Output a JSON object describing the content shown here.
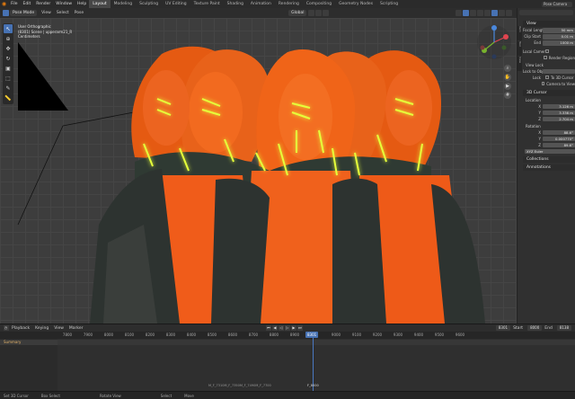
{
  "menu": {
    "items": [
      "File",
      "Edit",
      "Render",
      "Window",
      "Help"
    ],
    "workspaces": [
      "Layout",
      "Modeling",
      "Sculpting",
      "UV Editing",
      "Texture Paint",
      "Shading",
      "Animation",
      "Rendering",
      "Compositing",
      "Geometry Nodes",
      "Scripting"
    ],
    "active_workspace": "Layout",
    "scene": "Pose Camera"
  },
  "viewport_header": {
    "mode": "Pose Mode",
    "menus": [
      "View",
      "Select",
      "Pose"
    ],
    "transform": "Global"
  },
  "viewport": {
    "info_line1": "User Orthographic",
    "info_line2": "(8301) Scene | upperarm21_R",
    "info_line3": "Centimeters",
    "accent": "#4772b3"
  },
  "npanel": {
    "search_placeholder": "",
    "tabs": [
      "Item",
      "Tool",
      "View"
    ],
    "view": {
      "title": "View",
      "focal_length_label": "Focal Length",
      "focal_length": "50 mm",
      "clip_start_label": "Clip Start",
      "clip_start": "0.01 m",
      "clip_end_label": "End",
      "clip_end": "1000 m",
      "local_camera_label": "Local Camera",
      "render_region": "Render Region",
      "view_lock_title": "View Lock",
      "lock_to_object_label": "Lock to Obj...",
      "lock_label": "Lock",
      "to_3d_cursor": "To 3D Cursor",
      "camera_to_view": "Camera to View"
    },
    "cursor": {
      "title": "3D Cursor",
      "location_label": "Location",
      "x_label": "X",
      "x": "3.126 m",
      "y_label": "Y",
      "y": "3.336 m",
      "z_label": "Z",
      "z": "2.704 m",
      "rotation_label": "Rotation",
      "rx": "88.6°",
      "ry": "0.000770°",
      "rz": "89.6°",
      "euler": "XYZ Euler"
    },
    "collections": "Collections",
    "annotations": "Annotations"
  },
  "timeline": {
    "menus": [
      "Playback",
      "Keying",
      "View",
      "Marker"
    ],
    "current_frame": "8301",
    "start_label": "Start",
    "start": "8000",
    "end_label": "End",
    "end": "8138",
    "ticks": [
      "7800",
      "7900",
      "8000",
      "8100",
      "8200",
      "8300",
      "8400",
      "8500",
      "8600",
      "8700",
      "8800",
      "8900",
      "9000",
      "9100",
      "9200",
      "9300",
      "9400",
      "9500",
      "9600"
    ],
    "summary": "Summary",
    "marker_labels": "M_F_7310M_F_7350M_F_7490M_F_7700",
    "marker_current": "F_8000",
    "playhead_label": "8301"
  },
  "statusbar": {
    "items": [
      "Set 3D Cursor",
      "Box Select",
      "Rotate View",
      "Select",
      "Move"
    ]
  }
}
